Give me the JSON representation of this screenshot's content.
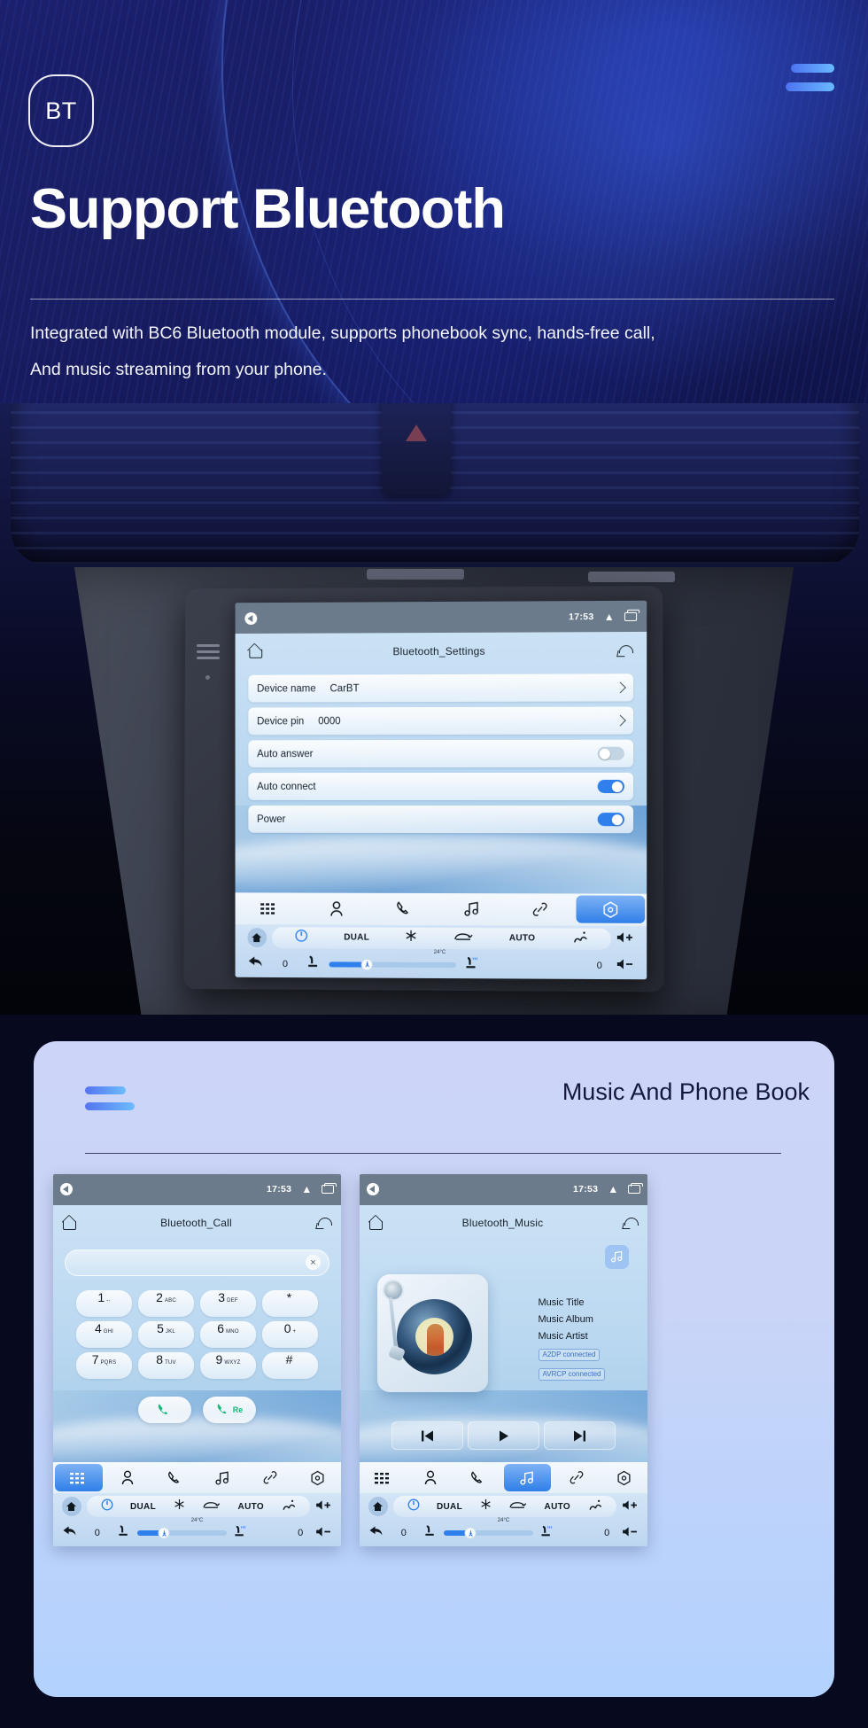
{
  "hero": {
    "badge": "BT",
    "title": "Support Bluetooth",
    "subtitle_line1": "Integrated with BC6 Bluetooth module, supports phonebook sync, hands-free call,",
    "subtitle_line2": "And music streaming from your phone.",
    "accent_gradient_start": "#4d73f0",
    "accent_gradient_end": "#68b9ff",
    "background_color": "#191d63"
  },
  "settings_screen": {
    "status": {
      "time": "17:53"
    },
    "title": "Bluetooth_Settings",
    "rows": [
      {
        "label": "Device name",
        "value": "CarBT",
        "control": "chevron"
      },
      {
        "label": "Device pin",
        "value": "0000",
        "control": "chevron"
      },
      {
        "label": "Auto answer",
        "value": "",
        "control": "toggle-off"
      },
      {
        "label": "Auto connect",
        "value": "",
        "control": "toggle-on"
      },
      {
        "label": "Power",
        "value": "",
        "control": "toggle-on"
      }
    ],
    "appbar": [
      "apps-icon",
      "contacts-icon",
      "phone-icon",
      "music-icon",
      "link-icon",
      "settings-icon"
    ],
    "appbar_active_index": 5,
    "climate": {
      "power": "power-icon",
      "dual": "DUAL",
      "ac": "snowflake-icon",
      "recirc": "recirculation-icon",
      "auto": "AUTO",
      "defrost": "defrost-icon",
      "temp": "24°C",
      "left_value": "0",
      "right_value": "0",
      "vol_up": "volume-up-icon",
      "vol_down": "volume-down-icon"
    }
  },
  "card": {
    "title": "Music And Phone Book"
  },
  "call_screen": {
    "status": {
      "time": "17:53"
    },
    "title": "Bluetooth_Call",
    "input_value": "",
    "clear_label": "×",
    "keys": [
      {
        "digit": "1",
        "sub": "--"
      },
      {
        "digit": "2",
        "sub": "ABC"
      },
      {
        "digit": "3",
        "sub": "DEF"
      },
      {
        "digit": "*",
        "sub": ""
      },
      {
        "digit": "4",
        "sub": "GHI"
      },
      {
        "digit": "5",
        "sub": "JKL"
      },
      {
        "digit": "6",
        "sub": "MNO"
      },
      {
        "digit": "0",
        "sub": "+"
      },
      {
        "digit": "7",
        "sub": "PQRS"
      },
      {
        "digit": "8",
        "sub": "TUV"
      },
      {
        "digit": "9",
        "sub": "WXYZ"
      },
      {
        "digit": "#",
        "sub": ""
      }
    ],
    "call_button": "phone-icon",
    "redial_button_label": "Re",
    "appbar_active_index": 0,
    "climate": {
      "dual": "DUAL",
      "auto": "AUTO",
      "temp": "24°C",
      "left_value": "0",
      "right_value": "0"
    }
  },
  "music_screen": {
    "status": {
      "time": "17:53"
    },
    "title": "Bluetooth_Music",
    "badge_icon": "music-note-icon",
    "track_title": "Music Title",
    "album": "Music Album",
    "artist": "Music Artist",
    "tags": [
      "A2DP  connected",
      "AVRCP connected"
    ],
    "transport": [
      "previous-icon",
      "play-icon",
      "next-icon"
    ],
    "appbar_active_index": 3,
    "climate": {
      "dual": "DUAL",
      "auto": "AUTO",
      "temp": "24°C",
      "left_value": "0",
      "right_value": "0"
    }
  }
}
